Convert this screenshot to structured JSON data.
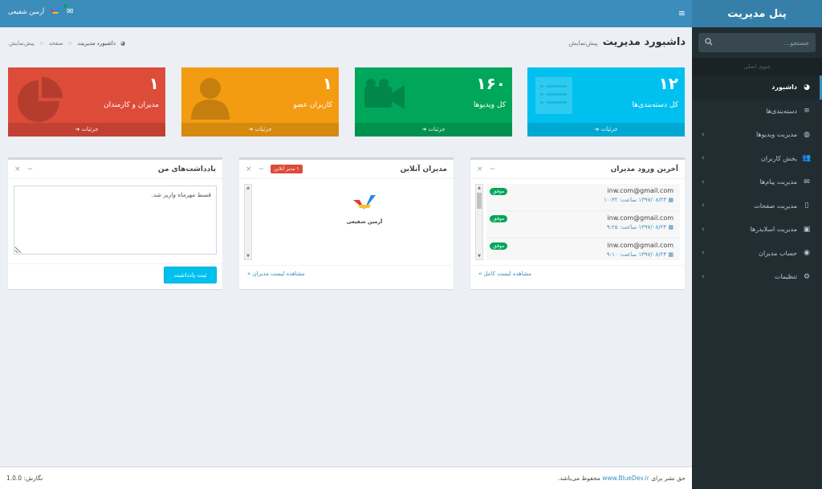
{
  "sidebar": {
    "brand": "پنل مدیریت",
    "search_placeholder": "جستجو...",
    "menu_header": "منوی اصلی",
    "items": [
      {
        "label": "داشبورد",
        "icon": "dashboard-icon",
        "glyph": "◕",
        "active": true,
        "chevron": false
      },
      {
        "label": "دسته‌بندی‌ها",
        "icon": "list-icon",
        "glyph": "≡",
        "active": false,
        "chevron": false
      },
      {
        "label": "مدیریت ویدیوها",
        "icon": "video-icon",
        "glyph": "◍",
        "active": false,
        "chevron": true
      },
      {
        "label": "بخش کاربران",
        "icon": "users-icon",
        "glyph": "👥",
        "active": false,
        "chevron": true
      },
      {
        "label": "مدیریت پیام‌ها",
        "icon": "envelope-icon",
        "glyph": "✉",
        "active": false,
        "chevron": true
      },
      {
        "label": "مدیریت صفحات",
        "icon": "file-icon",
        "glyph": "▯",
        "active": false,
        "chevron": true
      },
      {
        "label": "مدیریت اسلایدرها",
        "icon": "image-icon",
        "glyph": "▣",
        "active": false,
        "chevron": true
      },
      {
        "label": "حساب مدیران",
        "icon": "user-circle-icon",
        "glyph": "◉",
        "active": false,
        "chevron": true
      },
      {
        "label": "تنظیمات",
        "icon": "gear-icon",
        "glyph": "⚙",
        "active": false,
        "chevron": true
      }
    ]
  },
  "topbar": {
    "username": "آرمین شفیعی",
    "hamburger": "≡",
    "envelope": "✉"
  },
  "header": {
    "title": "داشبورد مدیریت",
    "subtitle": "پیش‌نمایش",
    "breadcrumb": [
      "داشبورد مدیریت",
      "صفحه",
      "پیش‌نمایش"
    ]
  },
  "stats": [
    {
      "number": "۱۲",
      "label": "کل دسته‌بندی‌ها",
      "footer": "جزئیات",
      "color": "#00c0ef"
    },
    {
      "number": "۱۶۰",
      "label": "کل ویدیوها",
      "footer": "جزئیات",
      "color": "#00a65a"
    },
    {
      "number": "۱",
      "label": "کاربران عضو",
      "footer": "جزئیات",
      "color": "#f39c12"
    },
    {
      "number": "۱",
      "label": "مدیران و کارمندان",
      "footer": "جزئیات",
      "color": "#dd4b39"
    }
  ],
  "recent_logins": {
    "title": "آخرین ورود مدیران",
    "items": [
      {
        "email": "inw.com@gmail.com",
        "date": "۱۳۹۷/۰۸/۲۳ ساعت: ۱۰:۳۲",
        "status": "موفق"
      },
      {
        "email": "inw.com@gmail.com",
        "date": "۱۳۹۷/۰۸/۲۳ ساعت: ۹:۲۵",
        "status": "موفق"
      },
      {
        "email": "inw.com@gmail.com",
        "date": "۱۳۹۷/۰۸/۲۳ ساعت: ۹:۱۰",
        "status": "موفق"
      }
    ],
    "footer": "مشاهده لیست کامل »"
  },
  "online_admins": {
    "title": "مدیران آنلاین",
    "badge": "۱ مدیر آنلاین",
    "user_name": "آرمین شفیعی",
    "footer": "مشاهده لیست مدیران »"
  },
  "notes": {
    "title": "یادداشت‌های من",
    "text": "قسط مهرماه واریز شد.",
    "button": "ثبت یادداشت"
  },
  "footer": {
    "copyright_prefix": "حق نشر برای",
    "copyright_link": "www.BlueDev.ir",
    "copyright_suffix": "محفوظ می‌باشد.",
    "version": "نگارش: 1.0.0"
  },
  "box_tools": {
    "minimize": "−",
    "close": "×"
  }
}
